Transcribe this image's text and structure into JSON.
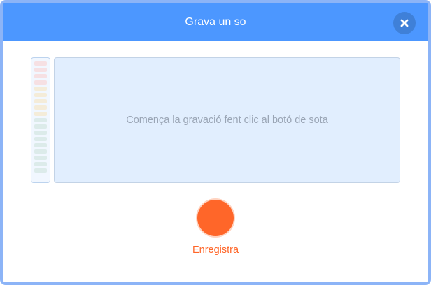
{
  "dialog": {
    "title": "Grava un so",
    "close_icon": "close-icon",
    "header_color": "#4c97ff"
  },
  "recorder": {
    "instructions": "Comença la gravació fent clic al botó de sota",
    "record_label": "Enregistra",
    "record_color": "#ff6629",
    "level_meter": {
      "level": 0,
      "segments": [
        "#f6e0e3",
        "#f6e0e3",
        "#f6e0e3",
        "#f6e0e3",
        "#f4ecd9",
        "#f4ecd9",
        "#f4ecd9",
        "#f4ecd9",
        "#f4ecd9",
        "#dcebea",
        "#dcebea",
        "#dcebea",
        "#dcebea",
        "#dcebea",
        "#dcebea",
        "#dcebea",
        "#dcebea",
        "#dcebea"
      ]
    }
  }
}
